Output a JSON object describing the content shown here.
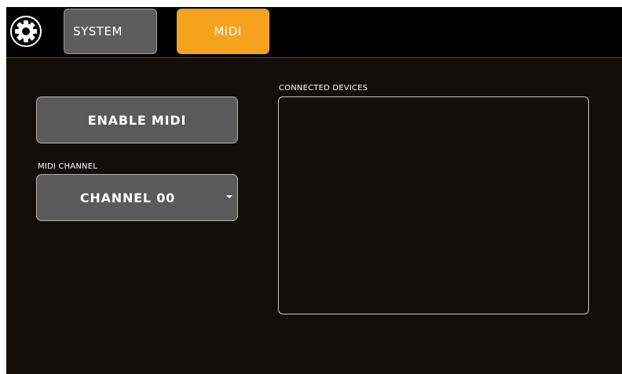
{
  "tabs": [
    {
      "label": "SYSTEM",
      "active": false
    },
    {
      "label": "MIDI",
      "active": true
    }
  ],
  "settings_icon": "gear-icon",
  "colors": {
    "accent": "#f5a21c",
    "background": "#120e0a",
    "topbar": "#000000",
    "button": "#5a5a5a"
  },
  "midi": {
    "enable_label": "ENABLE MIDI",
    "channel_label": "MIDI CHANNEL",
    "channel_value": "CHANNEL 00",
    "channel_caret_icon": "caret-down-icon",
    "connected_devices_label": "CONNECTED DEVICES",
    "connected_devices": []
  }
}
